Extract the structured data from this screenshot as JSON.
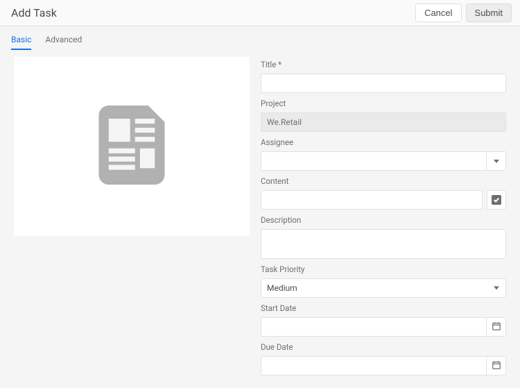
{
  "header": {
    "title": "Add Task",
    "cancel": "Cancel",
    "submit": "Submit"
  },
  "tabs": {
    "basic": "Basic",
    "advanced": "Advanced"
  },
  "form": {
    "titleLabel": "Title *",
    "titleValue": "",
    "projectLabel": "Project",
    "projectValue": "We.Retail",
    "assigneeLabel": "Assignee",
    "assigneeValue": "",
    "contentLabel": "Content",
    "contentValue": "",
    "descriptionLabel": "Description",
    "descriptionValue": "",
    "priorityLabel": "Task Priority",
    "priorityValue": "Medium",
    "startDateLabel": "Start Date",
    "startDateValue": "",
    "dueDateLabel": "Due Date",
    "dueDateValue": ""
  }
}
